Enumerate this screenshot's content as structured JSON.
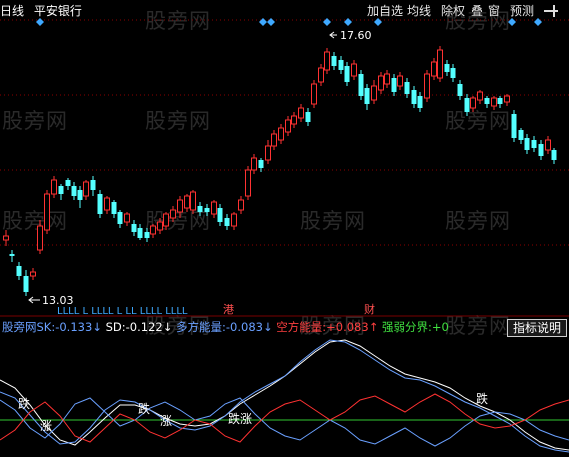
{
  "header": {
    "period": "日线",
    "stock_name": "平安银行"
  },
  "toolbar": {
    "items": [
      "加自选",
      "均线",
      "除权",
      "叠",
      "窗",
      "预测"
    ],
    "pin_icon": "pin-icon"
  },
  "watermark": "股旁网",
  "price_labels": {
    "high": "17.60",
    "low": "13.03"
  },
  "event_markers": {
    "left": "LLLL L LLLL L LL LLLL LLLL",
    "gang": "港",
    "cai": "财"
  },
  "indicator": {
    "name": "股旁网",
    "items": [
      {
        "label": "SK:",
        "value": "-0.133",
        "color": "#6aa0ff"
      },
      {
        "label": "SD:",
        "value": "-0.122",
        "color": "#ffffff"
      },
      {
        "label": "多方能量:",
        "value": "-0.083",
        "color": "#6aa0ff"
      },
      {
        "label": "空方能量:",
        "value": "+0.083",
        "color": "#ff4040"
      },
      {
        "label": "强弱分界:",
        "value": "+0",
        "color": "#40e040"
      }
    ],
    "button": "指标说明"
  },
  "osc_labels": {
    "die": "跌",
    "zhang": "涨",
    "diezhang": "跌涨"
  },
  "colors": {
    "up": "#ff3232",
    "down": "#54ffff",
    "grid": "#8b0000",
    "sk": "#6aa0ff",
    "sd": "#ffffff",
    "kong": "#ff3232",
    "mid": "#32c832",
    "diamond": "#3fa9ff"
  }
}
